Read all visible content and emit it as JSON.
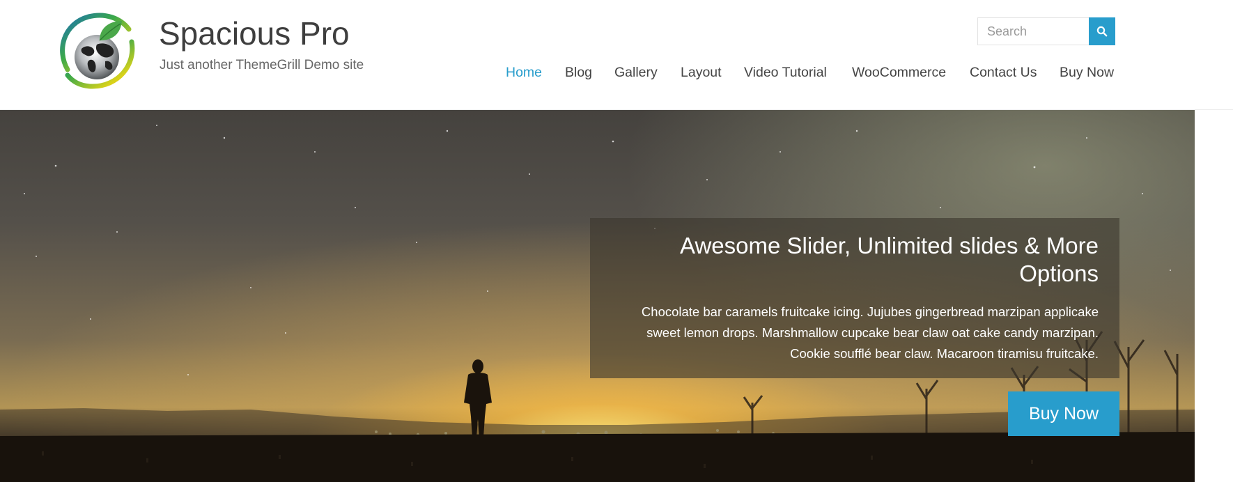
{
  "header": {
    "site_title": "Spacious Pro",
    "tagline": "Just another ThemeGrill Demo site",
    "search_placeholder": "Search"
  },
  "nav": {
    "items": [
      {
        "label": "Home",
        "active": true
      },
      {
        "label": "Blog",
        "active": false
      },
      {
        "label": "Gallery",
        "active": false
      },
      {
        "label": "Layout",
        "active": false
      },
      {
        "label": "Video Tutorial",
        "active": false
      },
      {
        "label": "WooCommerce",
        "active": false
      },
      {
        "label": "Contact Us",
        "active": false
      },
      {
        "label": "Buy Now",
        "active": false
      }
    ]
  },
  "slider": {
    "title": "Awesome Slider, Unlimited slides & More Options",
    "text": "Chocolate bar caramels fruitcake icing. Jujubes gingerbread marzipan applicake sweet lemon drops. Marshmallow cupcake bear claw oat cake candy marzipan. Cookie soufflé bear claw. Macaroon tiramisu fruitcake.",
    "button_label": "Buy Now"
  },
  "colors": {
    "accent": "#289dcc",
    "text": "#444444"
  },
  "icons": {
    "search": "search-icon",
    "logo": "globe-leaf-logo"
  }
}
